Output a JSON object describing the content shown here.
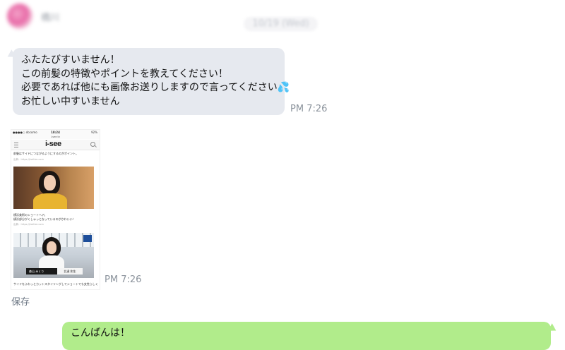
{
  "header": {
    "sender_name": "橋川",
    "date": "10/19 (Wed)"
  },
  "incoming_message": {
    "lines": [
      "ふたたびすいません！",
      "この前髪の特徴やポイントを教えてください！",
      "必要であれば他にも画像お送りしますので言ってください💦",
      "お忙しい中すいません"
    ],
    "time": "PM 7:26"
  },
  "image_message": {
    "time": "PM 7:26",
    "save_label": "保存",
    "screenshot": {
      "status_left": "●●●●○ docomo",
      "status_time": "18:24",
      "status_right": "92%",
      "url": "i-see.tv",
      "logo": "i-see",
      "caption_top": "前髪はサイドにつながるようにするのがポイント。",
      "source_1": "出典：https://twitter.com",
      "caption_mid_1": "横浜美術のショートヘア。",
      "caption_mid_2": "横浜部分がくしゅっとなっているのがかわいい！",
      "source_2": "出典：https://twitter.com",
      "name_band": "森山 みくり",
      "name_band_right": "北達 和生",
      "caption_bottom": "サイドをふわっとカットスタイリングしてショートでも女性らしく"
    }
  },
  "outgoing_message": {
    "text": "こんばんは！"
  },
  "icons": [
    "menu-icon",
    "search-icon"
  ],
  "colors": {
    "incoming_bubble": "#e6e9ef",
    "outgoing_bubble": "#b1ec8b",
    "timestamp": "#8b939c"
  }
}
